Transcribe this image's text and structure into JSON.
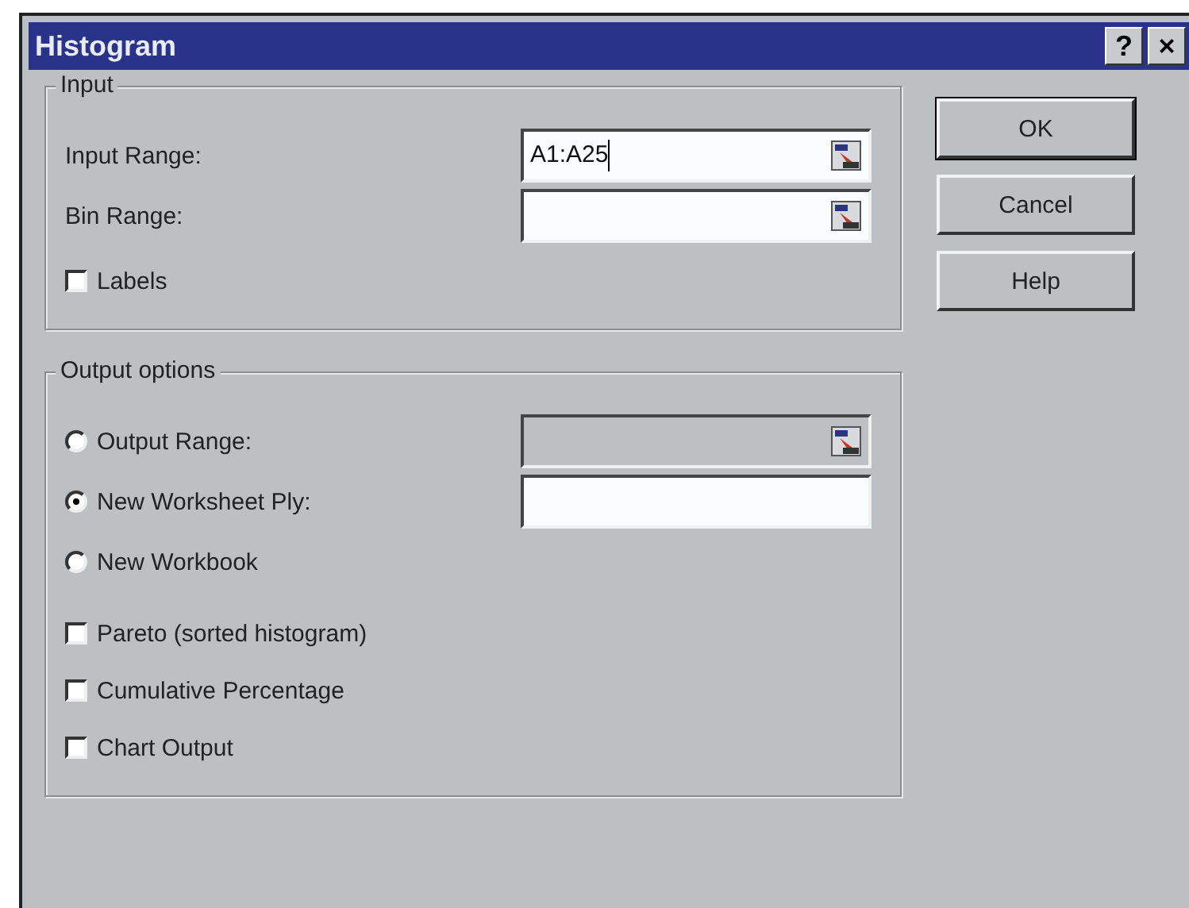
{
  "window": {
    "title": "Histogram",
    "title_buttons": [
      "?",
      "×"
    ]
  },
  "input": {
    "legend": "Input",
    "fields": [
      {
        "label": "Input Range:",
        "value": "A1:A25",
        "focused": true,
        "disabled": false,
        "picker": true
      },
      {
        "label": "Bin Range:",
        "focused": false,
        "disabled": false,
        "picker": true
      }
    ],
    "checkboxes": [
      {
        "label": "Labels",
        "checked": false
      }
    ]
  },
  "output": {
    "legend": "Output options",
    "radios": [
      {
        "label": "Output Range:",
        "selected": false,
        "field": {
          "disabled": true,
          "focused": false,
          "picker": true
        }
      },
      {
        "label": "New Worksheet Ply:",
        "selected": true,
        "field": {
          "disabled": false,
          "focused": false,
          "picker": false
        }
      },
      {
        "label": "New Workbook",
        "selected": false
      }
    ],
    "checkboxes": [
      {
        "label": "Pareto (sorted histogram)",
        "checked": false
      },
      {
        "label": "Cumulative Percentage",
        "checked": false
      },
      {
        "label": "Chart Output",
        "checked": false
      }
    ]
  },
  "buttons": [
    {
      "label": "OK",
      "default": true
    },
    {
      "label": "Cancel",
      "default": false
    },
    {
      "label": "Help",
      "default": false
    }
  ]
}
